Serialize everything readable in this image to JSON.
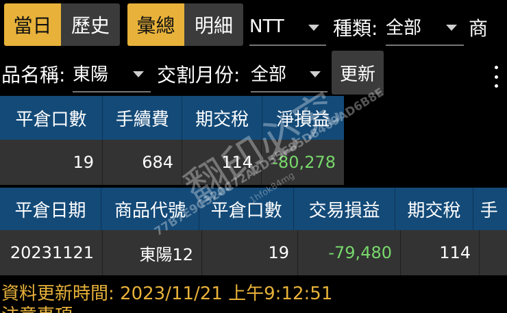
{
  "toolbar": {
    "tab_today": "當日",
    "tab_history": "歷史",
    "tab_summary": "彙總",
    "tab_detail": "明細",
    "currency_value": "NTT",
    "type_label": "種類:",
    "type_value": "全部",
    "product_label_part1": "商",
    "product_label_part2": "品名稱:",
    "product_value": "東陽",
    "month_label": "交割月份:",
    "month_value": "全部",
    "refresh_label": "更新"
  },
  "summary_table": {
    "headers": [
      "平倉口數",
      "手續費",
      "期交稅",
      "淨損益"
    ],
    "row": [
      "19",
      "684",
      "114",
      "-80,278"
    ]
  },
  "detail_table": {
    "headers": [
      "平倉日期",
      "商品代號",
      "平倉口數",
      "交易損益",
      "期交稅",
      "手"
    ],
    "row": [
      "20231121",
      "東陽12",
      "19",
      "-79,480",
      "114",
      ""
    ]
  },
  "status": {
    "update_time_text": "資料更新時間: 2023/11/21 上午9:12:51",
    "next_line_partial": "注意事項"
  },
  "watermark": {
    "large_text": "翻印必究",
    "hash_text": "77B7E9C320C72A2D55F85D8469AD6B8E",
    "user_text": "1hfok84mg"
  },
  "colors": {
    "accent": "#e8b23a",
    "header_blue": "#134a78",
    "negative": "#78d96b",
    "cell_dark": "#333333"
  }
}
